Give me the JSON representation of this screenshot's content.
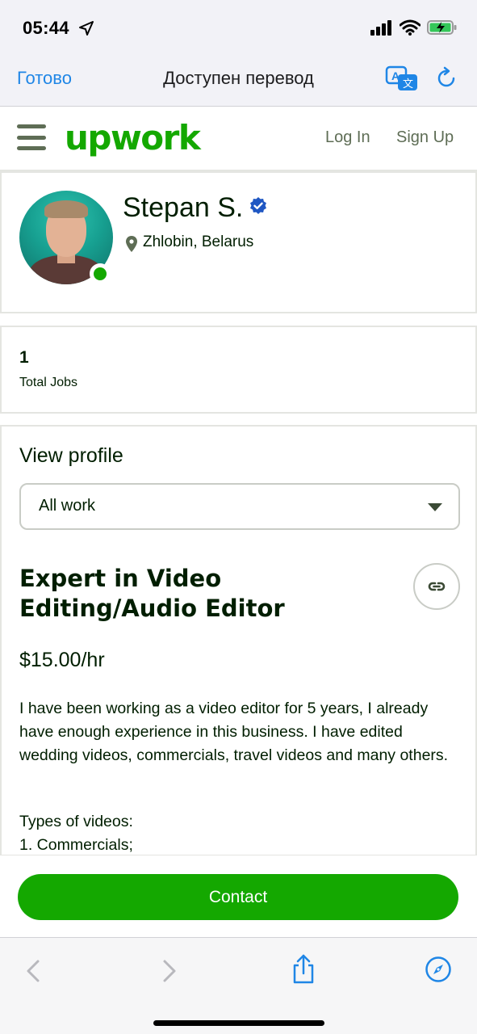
{
  "status_bar": {
    "time": "05:44",
    "icons": [
      "location-arrow-icon",
      "signal-icon",
      "wifi-icon",
      "battery-charging-icon"
    ]
  },
  "safari_top": {
    "done_label": "Готово",
    "title": "Доступен перевод",
    "icons": [
      "translate-icon",
      "reload-icon"
    ]
  },
  "header": {
    "logo": "upwork",
    "login_label": "Log In",
    "signup_label": "Sign Up"
  },
  "profile": {
    "name": "Stepan S.",
    "location": "Zhlobin, Belarus",
    "verified": true,
    "online": true
  },
  "stats": {
    "total_jobs_value": "1",
    "total_jobs_label": "Total Jobs"
  },
  "main": {
    "view_profile_label": "View profile",
    "select_value": "All work",
    "title": "Expert in Video Editing/Audio Editor",
    "rate": "$15.00/hr",
    "description": "I have been working as a video editor for 5 years, I already have enough experience in this business. I have edited wedding videos, commercials, travel videos and many others.",
    "types_label": "Types of videos:",
    "types_first": "1. Commercials;"
  },
  "contact": {
    "label": "Contact"
  },
  "colors": {
    "brand_green": "#14a800",
    "ios_blue": "#1f86e6",
    "text_dark": "#001e00",
    "muted_green": "#5e6d55"
  }
}
